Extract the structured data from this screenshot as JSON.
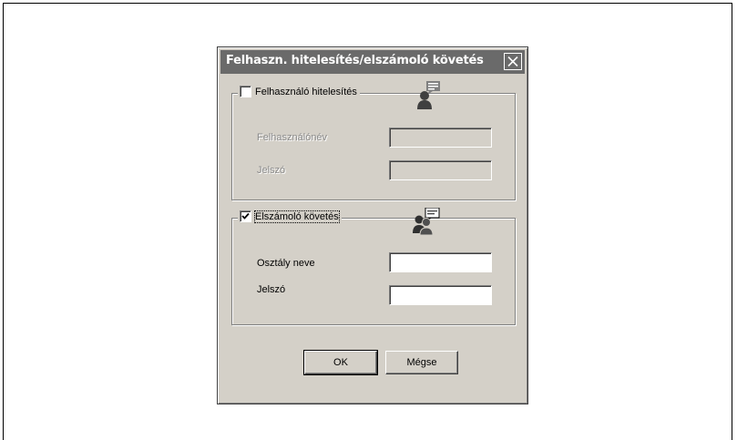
{
  "dialog": {
    "title": "Felhaszn. hitelesítés/elszámoló követés",
    "close_glyph": "X"
  },
  "user_auth": {
    "label": "Felhasználó hitelesítés",
    "checked": false,
    "icon": "user-speech-icon",
    "username_label": "Felhasználónév",
    "username_value": "",
    "password_label": "Jelszó",
    "password_value": ""
  },
  "account_track": {
    "label": "Elszámoló követés",
    "checked": true,
    "icon": "group-speech-icon",
    "department_label": "Osztály neve",
    "department_value": "",
    "password_label": "Jelszó",
    "password_value": ""
  },
  "buttons": {
    "ok": "OK",
    "cancel": "Mégse"
  }
}
